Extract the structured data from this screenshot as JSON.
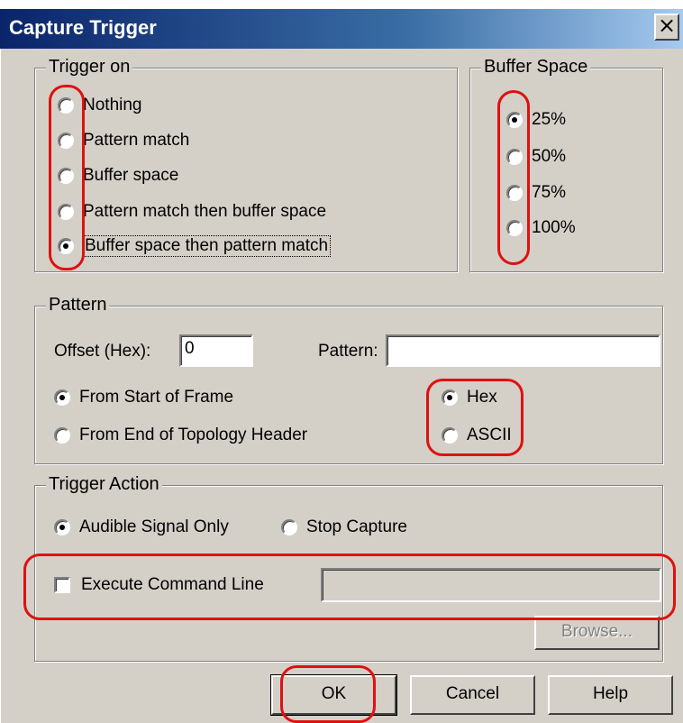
{
  "dialog": {
    "title": "Capture Trigger",
    "close_glyph": "×"
  },
  "trigger_on": {
    "legend": "Trigger on",
    "options": [
      {
        "label": "Nothing",
        "selected": false
      },
      {
        "label": "Pattern match",
        "selected": false
      },
      {
        "label": "Buffer space",
        "selected": false
      },
      {
        "label": "Pattern match then buffer space",
        "selected": false
      },
      {
        "label": "Buffer space then pattern match",
        "selected": true
      }
    ]
  },
  "buffer_space": {
    "legend": "Buffer Space",
    "options": [
      {
        "label": "25%",
        "selected": true
      },
      {
        "label": "50%",
        "selected": false
      },
      {
        "label": "75%",
        "selected": false
      },
      {
        "label": "100%",
        "selected": false
      }
    ]
  },
  "pattern": {
    "legend": "Pattern",
    "offset_label": "Offset (Hex):",
    "offset_value": "0",
    "pattern_label": "Pattern:",
    "pattern_value": "",
    "from_start": "From Start of Frame",
    "from_end": "From End of Topology Header",
    "hex": "Hex",
    "ascii": "ASCII"
  },
  "trigger_action": {
    "legend": "Trigger Action",
    "audible": "Audible Signal Only",
    "stop": "Stop Capture",
    "execute": "Execute Command Line",
    "command_value": "",
    "browse": "Browse..."
  },
  "buttons": {
    "ok": "OK",
    "cancel": "Cancel",
    "help": "Help"
  },
  "colors": {
    "annotation": "#e01010",
    "dialog_bg": "#d4d0c8",
    "title_bg": "#0a246a"
  }
}
